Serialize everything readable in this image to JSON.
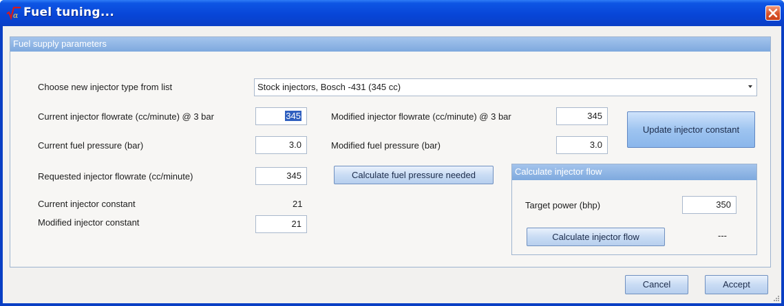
{
  "window": {
    "title": "Fuel tuning...",
    "icon": "sqrt-alpha-app-icon",
    "close_icon": "close-icon"
  },
  "supply_group": {
    "header": "Fuel supply parameters",
    "injector_type_label": "Choose new  injector type from list",
    "injector_type_value": "Stock injectors, Bosch -431 (345 cc)",
    "current_flow_label": "Current injector flowrate (cc/minute) @ 3 bar",
    "current_flow_value": "345",
    "current_pressure_label": "Current fuel pressure (bar)",
    "current_pressure_value": "3.0",
    "requested_flow_label": "Requested injector flowrate (cc/minute)",
    "requested_flow_value": "345",
    "current_constant_label": "Current injector constant",
    "current_constant_value": "21",
    "modified_constant_label": "Modified injector constant",
    "modified_constant_value": "21",
    "modified_flow_label": "Modified injector flowrate (cc/minute) @ 3 bar",
    "modified_flow_value": "345",
    "modified_pressure_label": "Modified fuel pressure (bar)",
    "modified_pressure_value": "3.0",
    "update_button": "Update injector constant",
    "calc_pressure_button": "Calculate fuel pressure needed"
  },
  "injector_flow_group": {
    "header": "Calculate injector flow",
    "target_power_label": "Target power (bhp)",
    "target_power_value": "350",
    "calc_flow_button": "Calculate injector flow",
    "result": "---"
  },
  "footer": {
    "cancel_button": "Cancel",
    "accept_button": "Accept"
  },
  "colors": {
    "titlebar": "#0846d8",
    "group_header": "#8fb4e4",
    "selection": "#2f5fbf"
  }
}
